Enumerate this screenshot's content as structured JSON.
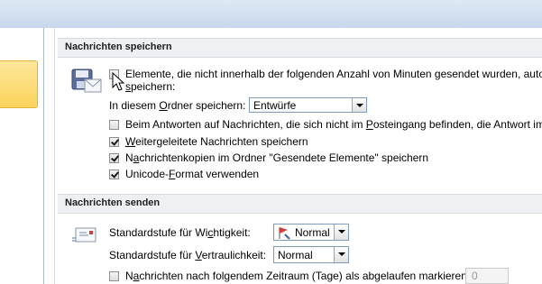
{
  "sections": {
    "save": {
      "title": "Nachrichten speichern",
      "autosave": {
        "line1": "Elemente, die nicht innerhalb der folgenden Anzahl von Minuten gesendet wurden, autom",
        "line2_underline": "s",
        "line2_rest": "peichern:",
        "checked": false
      },
      "folder": {
        "label_pre": "In diesem ",
        "label_u": "O",
        "label_post": "rdner speichern:",
        "value": "Entwürfe"
      },
      "reply_save": {
        "pre": "Beim Antworten auf Nachrichten, die sich nicht im ",
        "u": "P",
        "post": "osteingang befinden, die Antwort im",
        "checked": false
      },
      "forwarded": {
        "u": "W",
        "rest": "eitergeleitete Nachrichten speichern",
        "checked": true
      },
      "copies": {
        "pre": "N",
        "u": "a",
        "rest": "chrichtenkopien im Ordner \"Gesendete Elemente\" speichern",
        "checked": true
      },
      "unicode": {
        "pre": "Unicode-",
        "u": "F",
        "rest": "ormat verwenden",
        "checked": true
      }
    },
    "send": {
      "title": "Nachrichten senden",
      "importance": {
        "pre": "Standardstufe für Wi",
        "u": "c",
        "post": "htigkeit:",
        "value": "Normal"
      },
      "sensitivity": {
        "pre": "Standardstufe für ",
        "u": "V",
        "post": "ertraulichkeit:",
        "value": "Normal"
      },
      "expire": {
        "pre": "N",
        "u": "a",
        "post": "chrichten nach folgendem Zeitraum (Tage) als abgelaufen markieren:",
        "value": "0",
        "checked": false
      }
    }
  },
  "icons": {
    "save_section": "floppy-envelope-icon",
    "send_section": "envelope-icon",
    "importance": "importance-flag-icon",
    "cursor": "mouse-pointer-icon"
  }
}
